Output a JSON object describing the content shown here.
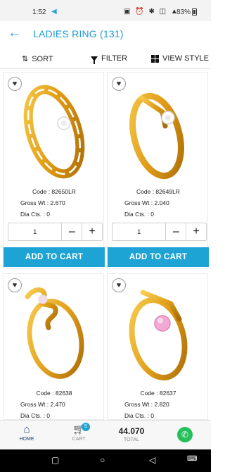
{
  "status_bar": {
    "time": "1:52",
    "battery": "83%"
  },
  "header": {
    "title": "LADIES RING (131)"
  },
  "toolbar": {
    "sort": "SORT",
    "filter": "FILTER",
    "view_style": "VIEW STYLE"
  },
  "products": [
    {
      "code": "Code : 82650LR",
      "gross_wt": "Gross Wt : 2.670",
      "dia_cts": "Dia Cts. : 0",
      "qty": "1",
      "add_to_cart": "ADD TO CART"
    },
    {
      "code": "Code : 82649LR",
      "gross_wt": "Gross Wt : 2.040",
      "dia_cts": "Dia Cts. : 0",
      "qty": "1",
      "add_to_cart": "ADD TO CART"
    },
    {
      "code": "Code : 82638",
      "gross_wt": "Gross Wt : 2.470",
      "dia_cts": "Dia Cts. : 0"
    },
    {
      "code": "Code : 82637",
      "gross_wt": "Gross Wt : 2.820",
      "dia_cts": "Dia Cts. : 0"
    }
  ],
  "bottom_nav": {
    "home": "HOME",
    "cart": "CART",
    "cart_count": "5",
    "total_value": "44.070",
    "total": "TOTAL"
  },
  "colors": {
    "accent": "#1ea4d4",
    "gold": "#e2a21a",
    "whatsapp": "#25c05a"
  }
}
